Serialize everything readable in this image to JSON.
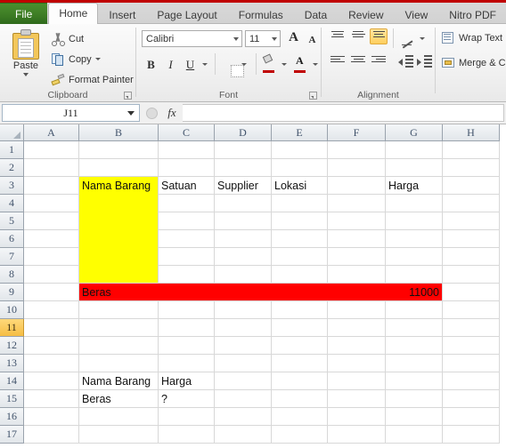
{
  "window": {
    "app": "Microsoft Excel 2010"
  },
  "ribbon_tabs": [
    {
      "label": "File",
      "active": false,
      "kind": "file"
    },
    {
      "label": "Home",
      "active": true,
      "kind": "normal"
    },
    {
      "label": "Insert",
      "active": false,
      "kind": "normal"
    },
    {
      "label": "Page Layout",
      "active": false,
      "kind": "normal"
    },
    {
      "label": "Formulas",
      "active": false,
      "kind": "normal"
    },
    {
      "label": "Data",
      "active": false,
      "kind": "normal"
    },
    {
      "label": "Review",
      "active": false,
      "kind": "normal"
    },
    {
      "label": "View",
      "active": false,
      "kind": "normal"
    },
    {
      "label": "Nitro PDF",
      "active": false,
      "kind": "normal"
    }
  ],
  "ribbon": {
    "clipboard": {
      "group_label": "Clipboard",
      "paste_label": "Paste",
      "cut_label": "Cut",
      "copy_label": "Copy",
      "format_painter_label": "Format Painter"
    },
    "font": {
      "group_label": "Font",
      "font_name": "Calibri",
      "font_size": "11",
      "bold_label": "B",
      "italic_label": "I",
      "underline_label": "U",
      "grow_font_label": "A",
      "shrink_font_label": "A",
      "font_color_label": "A"
    },
    "alignment": {
      "group_label": "Alignment",
      "wrap_text_label": "Wrap Text",
      "merge_center_label": "Merge & Center"
    }
  },
  "formula_bar": {
    "name_box_value": "J11",
    "fx_label": "fx",
    "formula_value": ""
  },
  "grid": {
    "columns": [
      "A",
      "B",
      "C",
      "D",
      "E",
      "F",
      "G",
      "H"
    ],
    "rows": [
      "1",
      "2",
      "3",
      "4",
      "5",
      "6",
      "7",
      "8",
      "9",
      "10",
      "11",
      "12",
      "13",
      "14",
      "15",
      "16",
      "17"
    ],
    "selected_row": "11",
    "colors": {
      "yellow_fill": "#ffff00",
      "red_fill": "#ff0000",
      "row_header_selected": "#f5bd44"
    },
    "fills": [
      {
        "name": "yellow-block",
        "col_start": "B",
        "col_end": "B",
        "row_start": "3",
        "row_end": "8",
        "color": "#ffff00"
      },
      {
        "name": "red-row",
        "col_start": "B",
        "col_end": "G",
        "row_start": "9",
        "row_end": "9",
        "color": "#ff0000"
      }
    ],
    "cells": [
      {
        "ref": "B3",
        "value": "Nama Barang",
        "align": "left"
      },
      {
        "ref": "C3",
        "value": "Satuan",
        "align": "left"
      },
      {
        "ref": "D3",
        "value": "Supplier",
        "align": "left"
      },
      {
        "ref": "E3",
        "value": "Lokasi",
        "align": "left"
      },
      {
        "ref": "G3",
        "value": "Harga",
        "align": "left"
      },
      {
        "ref": "B9",
        "value": "Beras",
        "align": "left"
      },
      {
        "ref": "G9",
        "value": "11000",
        "align": "right"
      },
      {
        "ref": "B14",
        "value": "Nama Barang",
        "align": "left"
      },
      {
        "ref": "C14",
        "value": "Harga",
        "align": "left"
      },
      {
        "ref": "B15",
        "value": "Beras",
        "align": "left"
      },
      {
        "ref": "C15",
        "value": "?",
        "align": "left"
      }
    ]
  }
}
